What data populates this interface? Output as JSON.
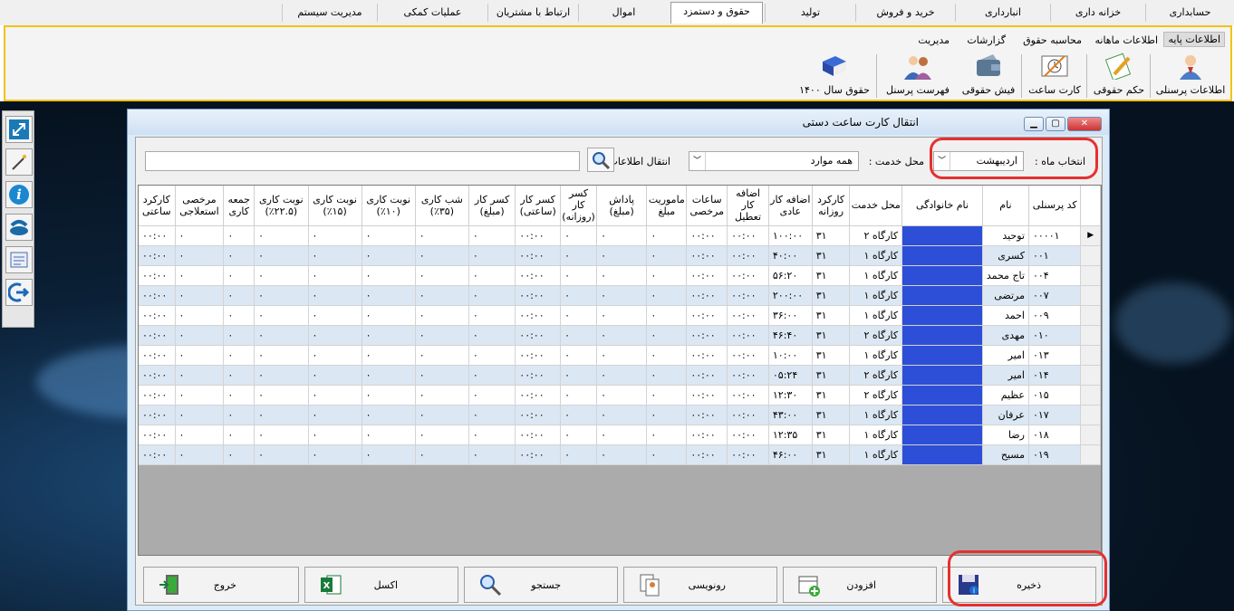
{
  "top_menu": [
    "حسابداری",
    "خزانه داری",
    "انبارداری",
    "خرید و فروش",
    "تولید",
    "حقوق و دستمزد",
    "اموال",
    "ارتباط با مشتریان",
    "عملیات کمکی",
    "مدیریت سیستم"
  ],
  "ribbon": {
    "subtabs": [
      "اطلاعات پایه",
      "اطلاعات ماهانه",
      "محاسبه حقوق",
      "گزارشات",
      "مدیریت"
    ],
    "buttons": [
      "اطلاعات پرسنلی",
      "حکم حقوقی",
      "کارت ساعت",
      "فیش حقوقی",
      "فهرست پرسنل",
      "حقوق سال ۱۴۰۰"
    ]
  },
  "window": {
    "title": "انتقال کارت ساعت دستی",
    "month_label": "انتخاب ماه :",
    "month_value": "اردیبهشت",
    "location_label": "محل خدمت :",
    "location_value": "همه موارد",
    "transfer_label": "انتقال اطلاعات",
    "columns": [
      "کد پرسنلی",
      "نام",
      "نام خانوادگی",
      "محل خدمت",
      "کارکرد روزانه",
      "اضافه کار عادی",
      "اضافه کار تعطیل",
      "ساعات مرخصی",
      "ماموریت مبلغ",
      "پاداش (مبلغ)",
      "کسر کار (روزانه)",
      "کسر کار (ساعتی)",
      "کسر کار (مبلغ)",
      "شب کاری (۳۵٪)",
      "نوبت کاری (۱۰٪)",
      "نوبت کاری (۱۵٪)",
      "نوبت کاری (۲۲.۵٪)",
      "جمعه کاری",
      "مرخصی استعلاجی",
      "کارکرد ساعتی"
    ],
    "rows": [
      {
        "code": "۰۰۰۰۱",
        "name": "توحید",
        "site": "کارگاه ۲",
        "days": "۳۱",
        "ot": "۱۰۰:۰۰"
      },
      {
        "code": "۰۰۱",
        "name": "کسری",
        "site": "کارگاه ۱",
        "days": "۳۱",
        "ot": "۴۰:۰۰"
      },
      {
        "code": "۰۰۴",
        "name": "تاج محمد",
        "site": "کارگاه ۱",
        "days": "۳۱",
        "ot": "۵۶:۲۰"
      },
      {
        "code": "۰۰۷",
        "name": "مرتضی",
        "site": "کارگاه ۱",
        "days": "۳۱",
        "ot": "۲۰۰:۰۰"
      },
      {
        "code": "۰۰۹",
        "name": "احمد",
        "site": "کارگاه ۱",
        "days": "۳۱",
        "ot": "۳۶:۰۰"
      },
      {
        "code": "۰۱۰",
        "name": "مهدی",
        "site": "کارگاه ۲",
        "days": "۳۱",
        "ot": "۴۶:۴۰"
      },
      {
        "code": "۰۱۳",
        "name": "امیر",
        "site": "کارگاه ۱",
        "days": "۳۱",
        "ot": "۱۰:۰۰"
      },
      {
        "code": "۰۱۴",
        "name": "امیر",
        "site": "کارگاه ۲",
        "days": "۳۱",
        "ot": "۰۵:۲۴"
      },
      {
        "code": "۰۱۵",
        "name": "عظیم",
        "site": "کارگاه ۲",
        "days": "۳۱",
        "ot": "۱۲:۳۰"
      },
      {
        "code": "۰۱۷",
        "name": "عرفان",
        "site": "کارگاه ۱",
        "days": "۳۱",
        "ot": "۴۳:۰۰"
      },
      {
        "code": "۰۱۸",
        "name": "رضا",
        "site": "کارگاه ۱",
        "days": "۳۱",
        "ot": "۱۲:۳۵"
      },
      {
        "code": "۰۱۹",
        "name": "مسیح",
        "site": "کارگاه ۱",
        "days": "۳۱",
        "ot": "۴۶:۰۰"
      }
    ],
    "zero_time": "۰۰:۰۰",
    "zero_num": "۰",
    "buttons": [
      "ذخیره",
      "افزودن",
      "رونویسی",
      "جستجو",
      "اکسل",
      "خروج"
    ]
  },
  "colors": {
    "accent_border": "#f2c312",
    "highlight": "#e53030",
    "family_cell": "#2d4fd8",
    "row_alt": "#dbe7f3"
  }
}
